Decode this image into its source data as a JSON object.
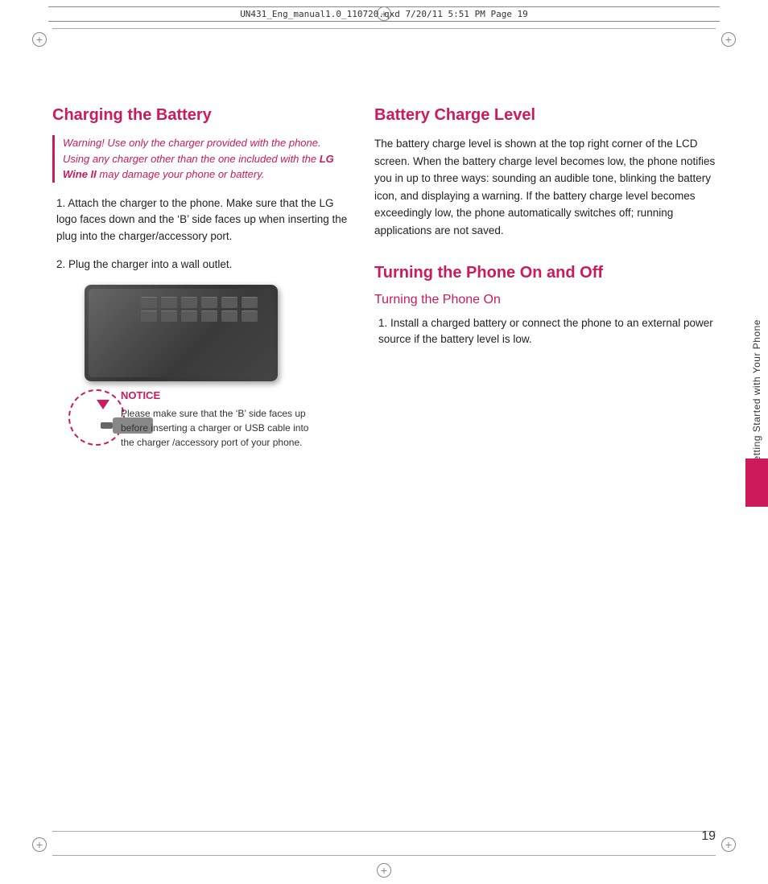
{
  "header": {
    "file_info": "UN431_Eng_manual1.0_110720.qxd   7/20/11   5:51 PM   Page 19"
  },
  "left_column": {
    "charging_title": "Charging the Battery",
    "warning_text": "Warning! Use only the charger provided with the phone. Using any charger other than the one included with the ",
    "warning_bold": "LG Wine II",
    "warning_text2": " may damage your phone or battery.",
    "step1": "1. Attach the charger to the phone. Make sure that the LG logo faces down and the ‘B’ side faces up when inserting the plug into the charger/accessory port.",
    "step2": "2. Plug the charger into a wall outlet.",
    "notice_title": "NOTICE",
    "notice_text": "Please make sure that the ‘B’ side faces up before inserting a charger or USB cable into the charger /accessory port of your phone."
  },
  "right_column": {
    "battery_charge_title": "Battery Charge Level",
    "battery_text": "The battery charge level is shown at the top right corner of the LCD screen. When the battery charge level becomes low, the phone notifies you in up to three ways: sounding an audible tone, blinking the battery icon, and displaying a warning. If the battery charge level becomes exceedingly low, the phone automatically switches off; running applications are not saved.",
    "turning_title": "Turning the Phone On and Off",
    "turning_subtitle": "Turning the Phone On",
    "turning_step1": "1. Install a charged battery or connect the phone to an external power source if the battery level is low."
  },
  "sidebar": {
    "tab_text": "Getting Started with Your Phone"
  },
  "page_number": "19"
}
